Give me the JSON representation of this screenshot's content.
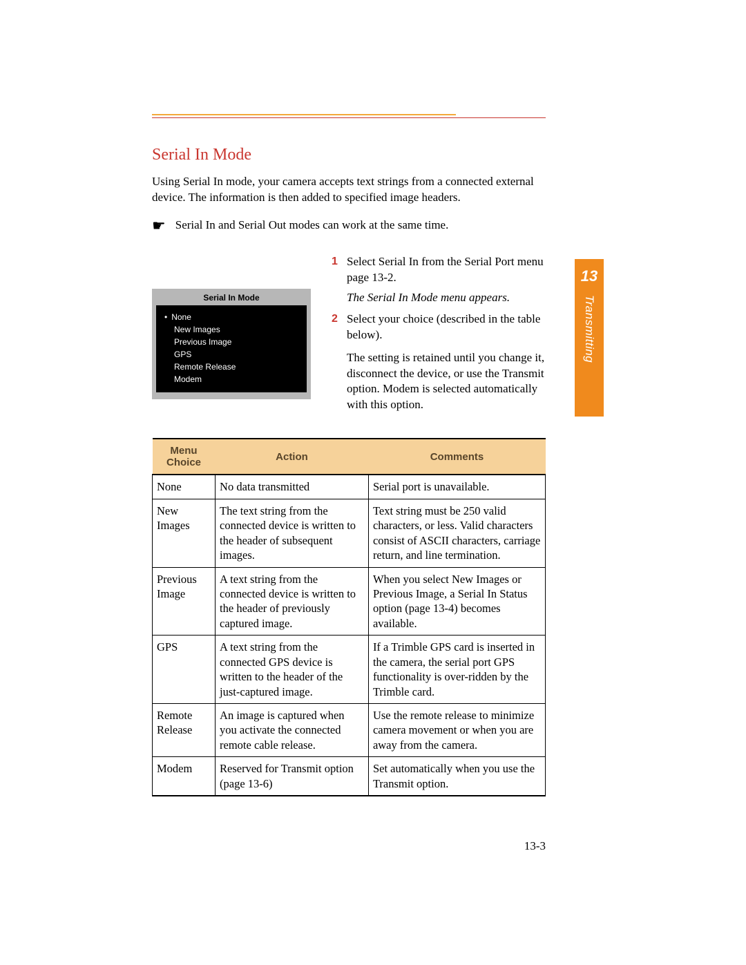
{
  "chapter": {
    "number": "13",
    "label": "Transmitting"
  },
  "section_title": "Serial In Mode",
  "intro": "Using Serial In mode, your camera accepts text strings from a connected external device. The information is then added to specified image headers.",
  "note": "Serial In and Serial Out modes can work at the same time.",
  "menu_screenshot": {
    "title": "Serial In Mode",
    "selected": "None",
    "items": [
      "New Images",
      "Previous Image",
      "GPS",
      "Remote Release",
      "Modem"
    ]
  },
  "steps": [
    {
      "num": "1",
      "text": "Select Serial In from the Serial Port menu  page 13-2."
    },
    {
      "num": "2",
      "text": "Select your choice (described in the table below)."
    }
  ],
  "step_result": "The Serial In Mode menu appears.",
  "step_note": "The setting is retained until you change it, disconnect the device, or use the Transmit option. Modem is selected automatically with this option.",
  "table": {
    "headers": [
      "Menu Choice",
      "Action",
      "Comments"
    ],
    "rows": [
      {
        "choice": "None",
        "action": "No data transmitted",
        "comments": "Serial port is unavailable."
      },
      {
        "choice": "New Images",
        "action": "The text string from the connected device is written to the header of subsequent images.",
        "comments": "Text string must be 250 valid characters, or less. Valid characters consist of ASCII characters, carriage return, and line termination."
      },
      {
        "choice": "Previous Image",
        "action": "A text string from the connected device is written to the header of previously captured image.",
        "comments": "When you select New Images or Previous Image, a Serial In Status option (page 13-4) becomes available."
      },
      {
        "choice": "GPS",
        "action": "A text string from the connected GPS device is written to the header of the just-captured image.",
        "comments": "If a Trimble GPS card is inserted in the camera, the serial port GPS functionality is over-ridden by the Trimble card."
      },
      {
        "choice": "Remote Release",
        "action": "An image is captured when you activate the connected remote cable release.",
        "comments": "Use the remote release to minimize camera movement or when you are away from the camera."
      },
      {
        "choice": "Modem",
        "action": "Reserved for Transmit option (page 13-6)",
        "comments": "Set automatically when you use the Transmit option."
      }
    ]
  },
  "page_number": "13-3"
}
